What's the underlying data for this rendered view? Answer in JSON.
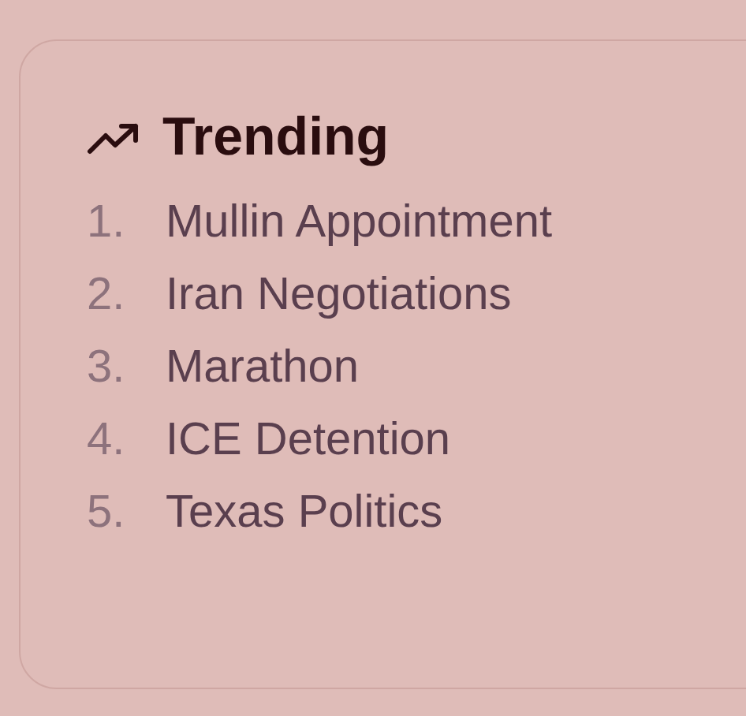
{
  "panel": {
    "title": "Trending",
    "items": [
      {
        "number": "1.",
        "label": "Mullin Appointment"
      },
      {
        "number": "2.",
        "label": "Iran Negotiations"
      },
      {
        "number": "3.",
        "label": "Marathon"
      },
      {
        "number": "4.",
        "label": "ICE Detention"
      },
      {
        "number": "5.",
        "label": "Texas Politics"
      }
    ]
  }
}
